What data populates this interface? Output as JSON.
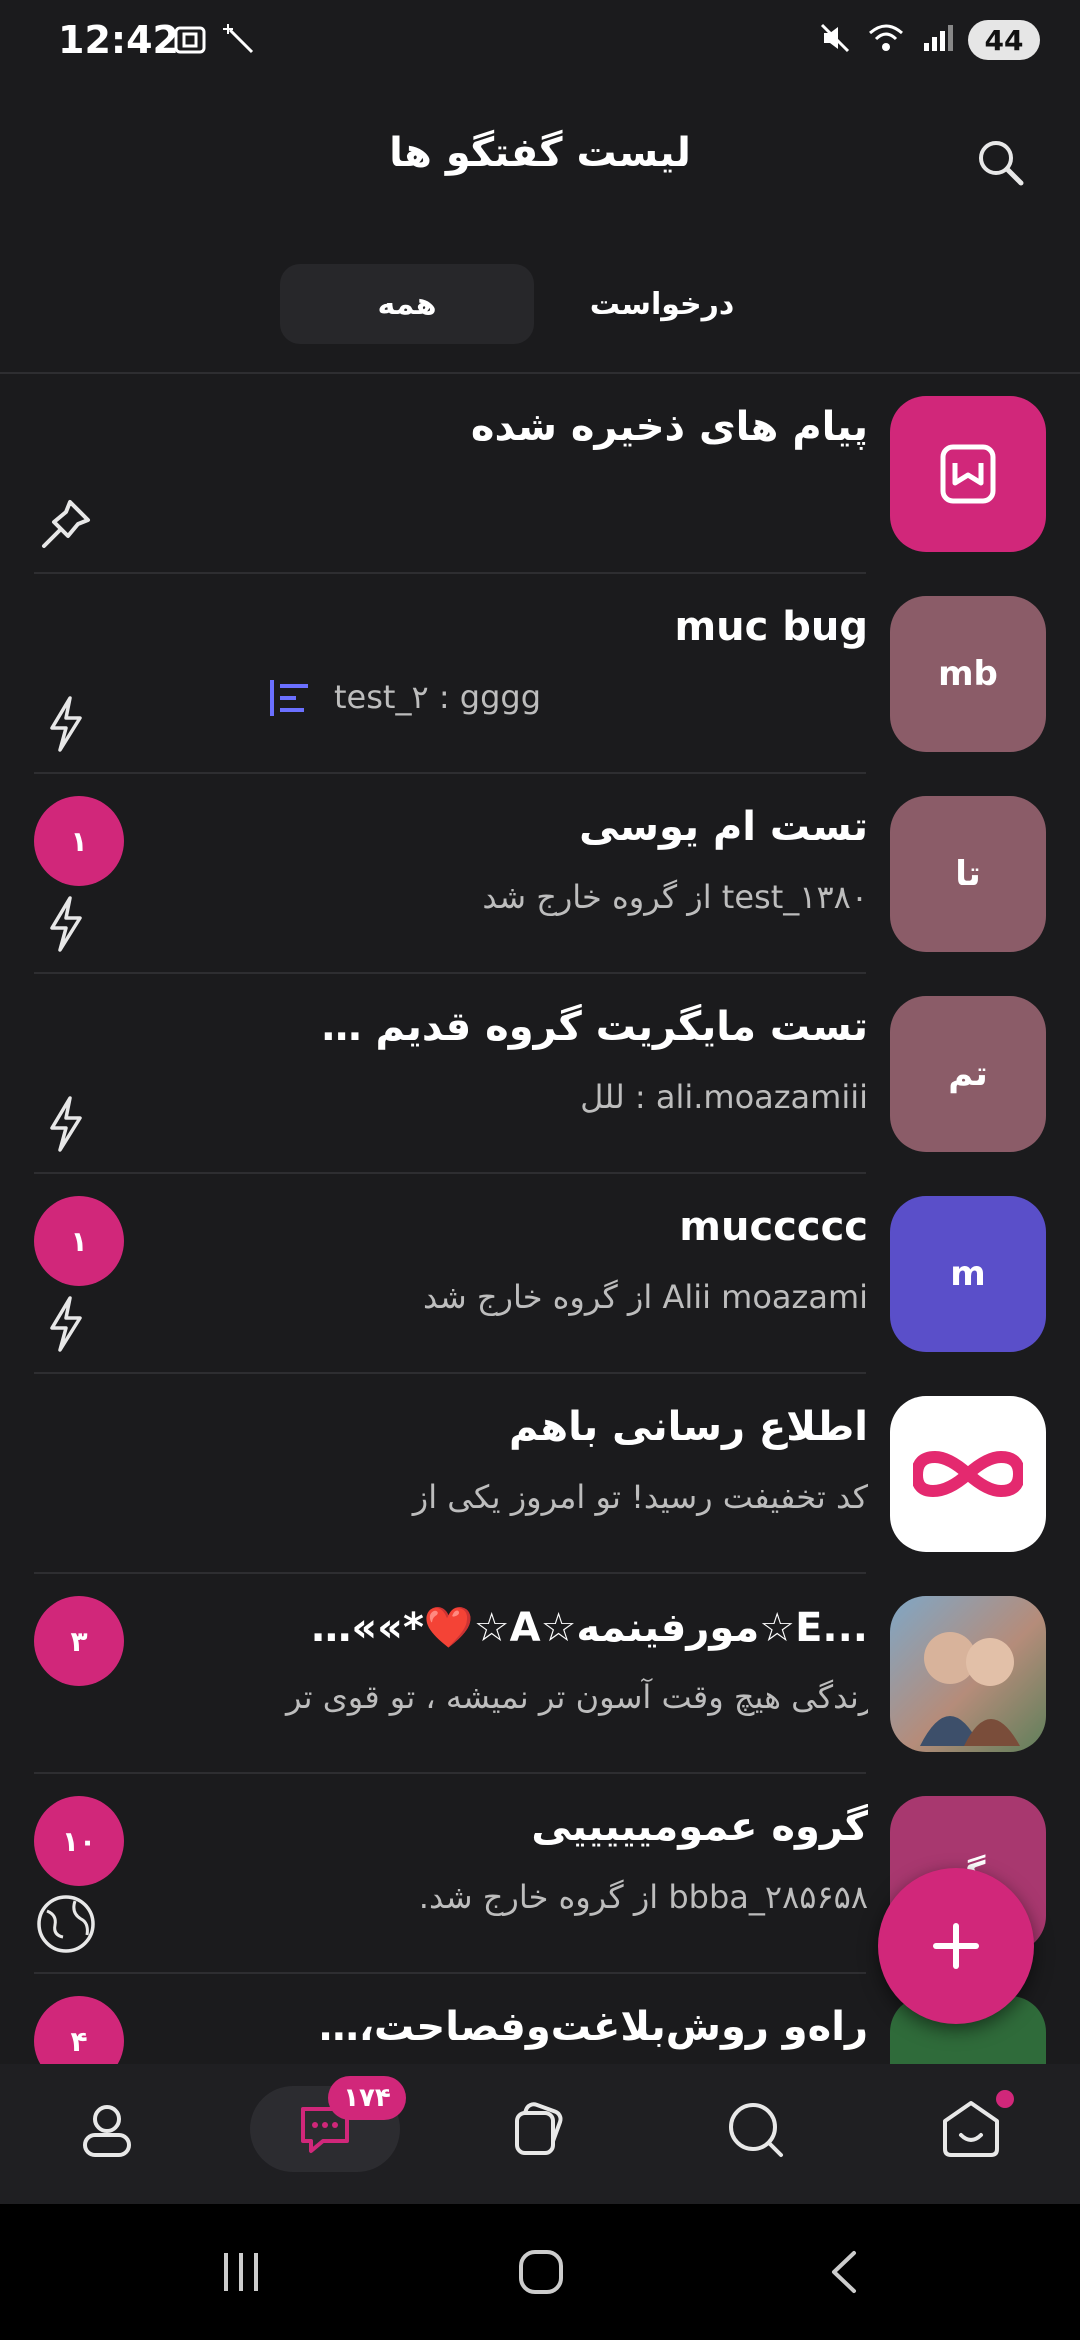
{
  "status_bar": {
    "time": "12:42",
    "battery": "44",
    "icons": [
      "screenshot-icon",
      "magic-icon",
      "mute-icon",
      "wifi-icon",
      "signal-icon"
    ]
  },
  "header": {
    "title": "لیست گفتگو ها",
    "search_icon": "search-icon"
  },
  "tabs": {
    "all": "همه",
    "requests": "درخواست"
  },
  "chats": [
    {
      "title": "پیام های ذخیره شده",
      "preview": "",
      "avatar_text": "",
      "avatar_color": "#d1277a",
      "badge": "",
      "side_icon": "pin-icon"
    },
    {
      "title": "muc bug",
      "preview": "test_۲ : gggg",
      "avatar_text": "mb",
      "avatar_color": "#8b5c68",
      "badge": "",
      "side_icon": "bolt-icon"
    },
    {
      "title": "تست ام یوسی",
      "preview": "test_۱۳۸۰ از گروه خارج شد",
      "avatar_text": "تا",
      "avatar_color": "#8b5c68",
      "badge": "۱",
      "side_icon": "bolt-icon"
    },
    {
      "title": "تست مایگریت گروه قدیم به...",
      "preview": "ali.moazamiii : للل",
      "avatar_text": "تم",
      "avatar_color": "#8b5c68",
      "badge": "",
      "side_icon": "bolt-icon"
    },
    {
      "title": "muccccc",
      "preview": "Alii moazami از گروه خارج شد",
      "avatar_text": "m",
      "avatar_color": "#5a4fc9",
      "badge": "۱",
      "side_icon": "bolt-icon"
    },
    {
      "title": "اطلاع رسانی باهم",
      "preview": "کد تخفیفت رسید! تو امروز یکی از",
      "avatar_text": "",
      "avatar_color": "#ffffff",
      "badge": "",
      "side_icon": ""
    },
    {
      "title": "...E☆مورفینمه☆A☆❤️*»»»»",
      "preview": "زندگی هیچ وقت آسون تر نمیشه ، تو قوی تر",
      "avatar_text": "",
      "avatar_color": "#6a8fb0",
      "badge": "۳",
      "side_icon": ""
    },
    {
      "title": "گروه عمومیییییی",
      "preview": "bbba_۲۸۵۶۵۸ از گروه خارج شد.",
      "avatar_text": "گ",
      "avatar_color": "#a8386f",
      "badge": "۱۰",
      "side_icon": "globe-icon"
    },
    {
      "title": "راه‌و روش‌بلاغت‌وفصاحت،نه...",
      "preview": "",
      "avatar_text": "",
      "avatar_color": "#2f6b3a",
      "badge": "۴",
      "side_icon": ""
    }
  ],
  "fab": {
    "icon": "plus-icon"
  },
  "bottom_nav": {
    "chats_badge": "۱۷۴",
    "items": [
      "profile-icon",
      "chat-icon",
      "cards-icon",
      "search-icon",
      "home-icon"
    ]
  },
  "colors": {
    "accent": "#d1277a",
    "background": "#1b1b1d"
  }
}
